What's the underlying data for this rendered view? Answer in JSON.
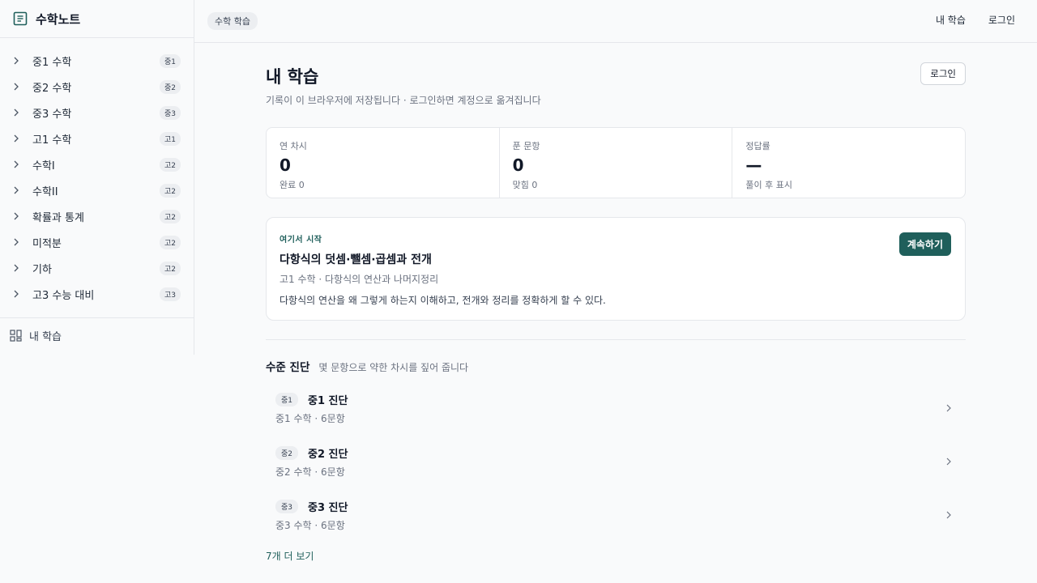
{
  "sidebar": {
    "brand": "수학노트",
    "items": [
      {
        "label": "중1 수학",
        "badge": "중1"
      },
      {
        "label": "중2 수학",
        "badge": "중2"
      },
      {
        "label": "중3 수학",
        "badge": "중3"
      },
      {
        "label": "고1 수학",
        "badge": "고1"
      },
      {
        "label": "수학I",
        "badge": "고2"
      },
      {
        "label": "수학II",
        "badge": "고2"
      },
      {
        "label": "확률과 통계",
        "badge": "고2"
      },
      {
        "label": "미적분",
        "badge": "고2"
      },
      {
        "label": "기하",
        "badge": "고2"
      },
      {
        "label": "고3 수능 대비",
        "badge": "고3"
      }
    ],
    "footer": "내 학습"
  },
  "topbar": {
    "breadcrumb": "수학 학습",
    "my_learning": "내 학습",
    "login": "로그인"
  },
  "main": {
    "title": "내 학습",
    "subtitle": "기록이 이 브라우저에 저장됩니다 · 로그인하면 계정으로 옮겨집니다",
    "login_button": "로그인",
    "stats": [
      {
        "label": "연 차시",
        "value": "0",
        "foot": "완료 0"
      },
      {
        "label": "푼 문항",
        "value": "0",
        "foot": "맞힘 0"
      },
      {
        "label": "정답률",
        "value": "—",
        "foot": "풀이 후 표시"
      }
    ],
    "start": {
      "eyebrow": "여기서 시작",
      "title": "다항식의 덧셈·뺄셈·곱셈과 전개",
      "path": "고1 수학 · 다항식의 연산과 나머지정리",
      "desc": "다항식의 연산을 왜 그렇게 하는지 이해하고, 전개와 정리를 정확하게 할 수 있다.",
      "button": "계속하기"
    },
    "diagnosis": {
      "title": "수준 진단",
      "subtitle": "몇 문항으로 약한 차시를 짚어 줍니다",
      "items": [
        {
          "badge": "중1",
          "name": "중1 진단",
          "meta": "중1 수학 · 6문항"
        },
        {
          "badge": "중2",
          "name": "중2 진단",
          "meta": "중2 수학 · 6문항"
        },
        {
          "badge": "중3",
          "name": "중3 진단",
          "meta": "중3 수학 · 6문항"
        }
      ],
      "more": "7개 더 보기"
    }
  },
  "colors": {
    "accent": "#1f5f5b",
    "background": "#f9fafb"
  }
}
